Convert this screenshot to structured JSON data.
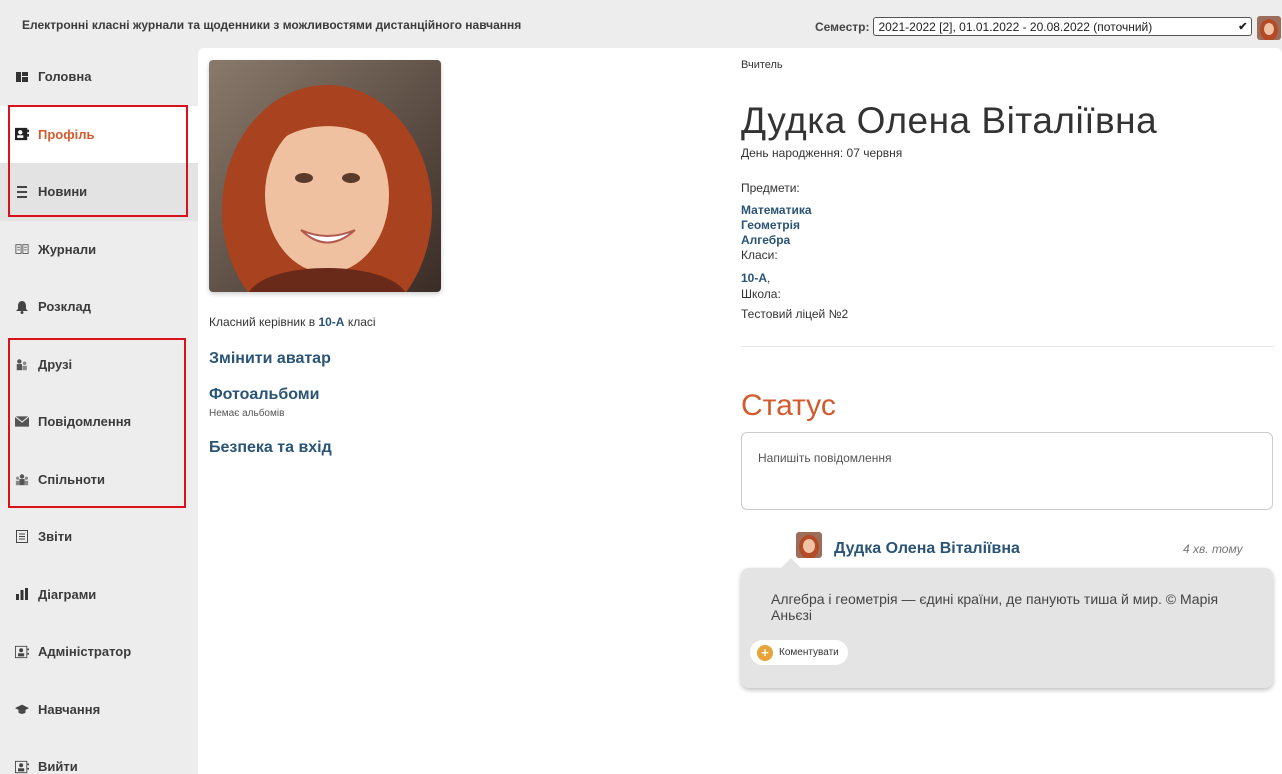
{
  "header": {
    "title": "Електронні класні журнали та щоденники з можливостями дистанційного навчання",
    "semester_label": "Семестр:",
    "semester_value": "2021-2022 [2], 01.01.2022 - 20.08.2022 (поточний)"
  },
  "sidebar": {
    "items": [
      {
        "label": "Головна",
        "icon": "home-icon"
      },
      {
        "label": "Профіль",
        "icon": "profile-card-icon"
      },
      {
        "label": "Новини",
        "icon": "news-icon"
      },
      {
        "label": "Журнали",
        "icon": "book-icon"
      },
      {
        "label": "Розклад",
        "icon": "bell-icon"
      },
      {
        "label": "Друзі",
        "icon": "friends-icon"
      },
      {
        "label": "Повідомлення",
        "icon": "envelope-icon"
      },
      {
        "label": "Спільноти",
        "icon": "community-icon"
      },
      {
        "label": "Звіти",
        "icon": "report-icon"
      },
      {
        "label": "Діаграми",
        "icon": "chart-icon"
      },
      {
        "label": "Адміністратор",
        "icon": "admin-icon"
      },
      {
        "label": "Навчання",
        "icon": "graduation-cap-icon"
      },
      {
        "label": "Вийти",
        "icon": "logout-icon"
      }
    ],
    "active_index": 1
  },
  "profile": {
    "class_head_prefix": "Класний керівник в",
    "class_head_class": "10-А",
    "class_head_suffix": "класі",
    "change_avatar": "Змінити аватар",
    "photo_albums": "Фотоальбоми",
    "no_albums": "Немає альбомів",
    "security": "Безпека та вхід",
    "role": "Вчитель",
    "full_name": "Дудка Олена Віталіївна",
    "birthday": "День народження: 07 червня",
    "subjects_label": "Предмети:",
    "subjects": [
      "Математика",
      "Геометрія",
      "Алгебра"
    ],
    "classes_label": "Класи:",
    "classes_value": "10-А",
    "classes_sep": ",",
    "school_label": "Школа:",
    "school_value": "Тестовий ліцей №2"
  },
  "status": {
    "title": "Статус",
    "placeholder": "Напишіть повідомлення"
  },
  "post": {
    "author": "Дудка Олена Віталіївна",
    "time": "4 хв. тому",
    "text": "Алгебра і геометрія — єдині країни, де панують тиша й мир. © Марія Аньєзі",
    "comment_label": "Коментувати"
  },
  "colors": {
    "accent": "#d25a2c",
    "link": "#2a5476",
    "highlight_frame": "#d8111b"
  }
}
